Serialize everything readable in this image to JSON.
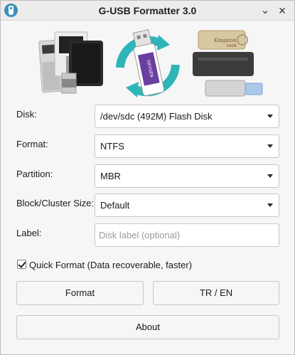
{
  "window": {
    "title": "G-USB Formatter 3.0",
    "minimize_glyph": "⌄",
    "close_glyph": "×"
  },
  "banner": {
    "left_image": "external-hard-drives",
    "center_image": "usb-drive-refresh-icon",
    "center_drive_text": "OXYGEN",
    "right_image": "usb-flash-drives",
    "right_drive_text": "Kingston",
    "right_drive_capacity": "64GB"
  },
  "form": {
    "disk": {
      "label": "Disk:",
      "value": "/dev/sdc (492M) Flash Disk"
    },
    "format": {
      "label": "Format:",
      "value": "NTFS"
    },
    "partition": {
      "label": "Partition:",
      "value": "MBR"
    },
    "block_size": {
      "label": "Block/Cluster Size:",
      "value": "Default"
    },
    "disk_label": {
      "label": "Label:",
      "value": "",
      "placeholder": "Disk label (optional)"
    }
  },
  "quick_format": {
    "checked": true,
    "label": "Quick Format (Data recoverable, faster)"
  },
  "buttons": {
    "format": "Format",
    "language": "TR / EN",
    "about": "About"
  },
  "colors": {
    "accent_teal": "#2fb5b8",
    "drive_purple": "#6a3fa0",
    "window_bg": "#f6f6f6"
  }
}
